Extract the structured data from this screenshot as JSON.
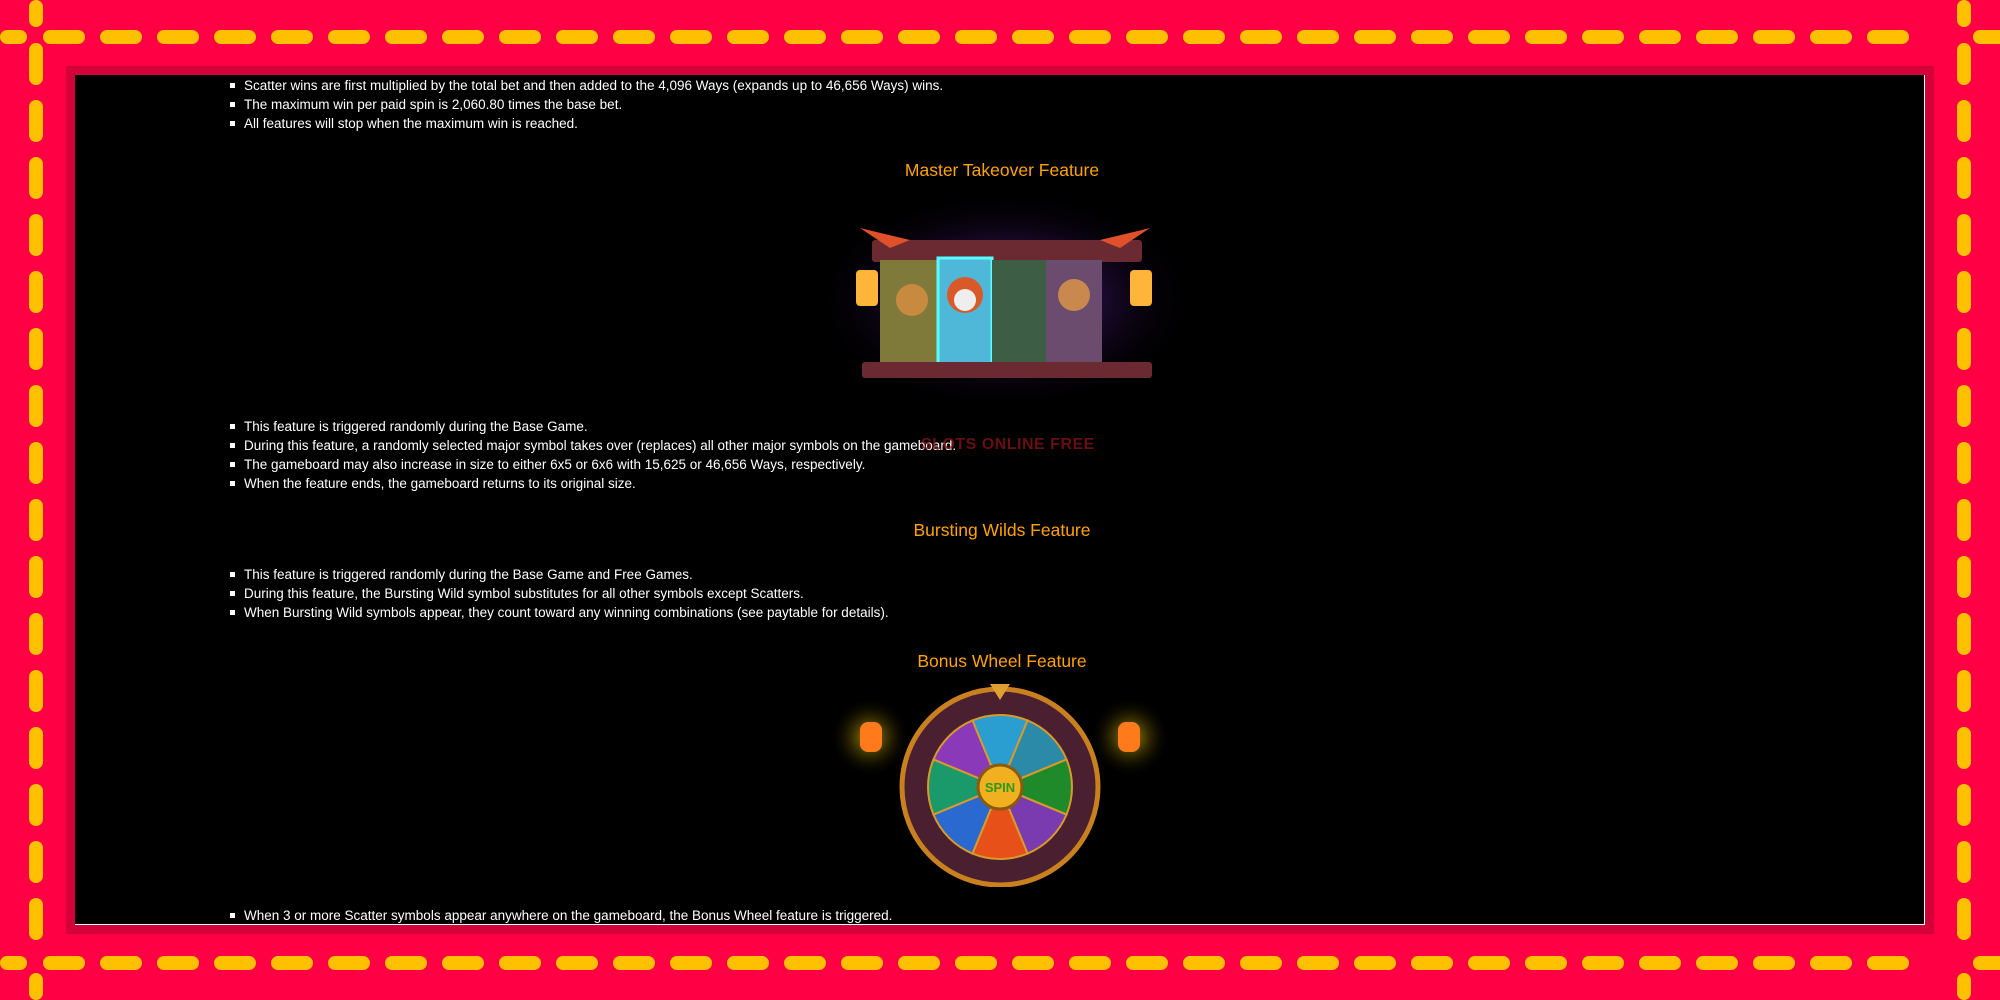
{
  "colors": {
    "frame": "#ff0044",
    "frame_inner": "#d4003a",
    "dash": "#ffc000",
    "heading": "#ffa300",
    "text": "#ffffff",
    "background": "#000000"
  },
  "intro": {
    "bullets": [
      "Scatter wins are first multiplied by the total bet and then added to the 4,096 Ways (expands up to 46,656 Ways) wins.",
      "The maximum win per paid spin is 2,060.80 times the base bet.",
      "All features will stop when the maximum win is reached."
    ]
  },
  "master_takeover": {
    "title": "Master Takeover Feature",
    "bullets": [
      "This feature is triggered randomly during the Base Game.",
      "During this feature, a randomly selected major symbol takes over (replaces) all other major symbols on the gameboard.",
      "The gameboard may also increase in size to either 6x5 or 6x6 with 15,625 or 46,656 Ways, respectively.",
      "When the feature ends, the gameboard returns to its original size."
    ]
  },
  "bursting_wilds": {
    "title": "Bursting Wilds Feature",
    "bullets": [
      "This feature is triggered randomly during the Base Game and Free Games.",
      "During this feature, the Bursting Wild symbol substitutes for all other symbols except Scatters.",
      "When Bursting Wild symbols appear, they count toward any winning combinations (see paytable for details)."
    ]
  },
  "bonus_wheel": {
    "title": "Bonus Wheel Feature",
    "wheel_center": "SPIN",
    "bullets": [
      "When 3 or more Scatter symbols appear anywhere on the gameboard, the Bonus Wheel feature is triggered."
    ]
  },
  "watermark": "SLOTS ONLINE FREE"
}
